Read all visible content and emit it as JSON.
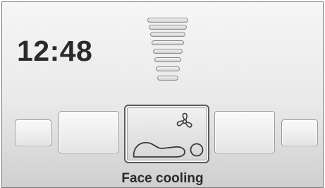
{
  "clock": {
    "time": "12:48"
  },
  "fan_speed": {
    "levels": 8
  },
  "mode_selector": {
    "selected_label": "Face cooling",
    "selected_icons": [
      "fan-icon",
      "reclined-person-icon"
    ]
  },
  "colors": {
    "text": "#2b2b2b",
    "tile_border": "#9a9a9a",
    "selected_border": "#5a5a5a"
  }
}
